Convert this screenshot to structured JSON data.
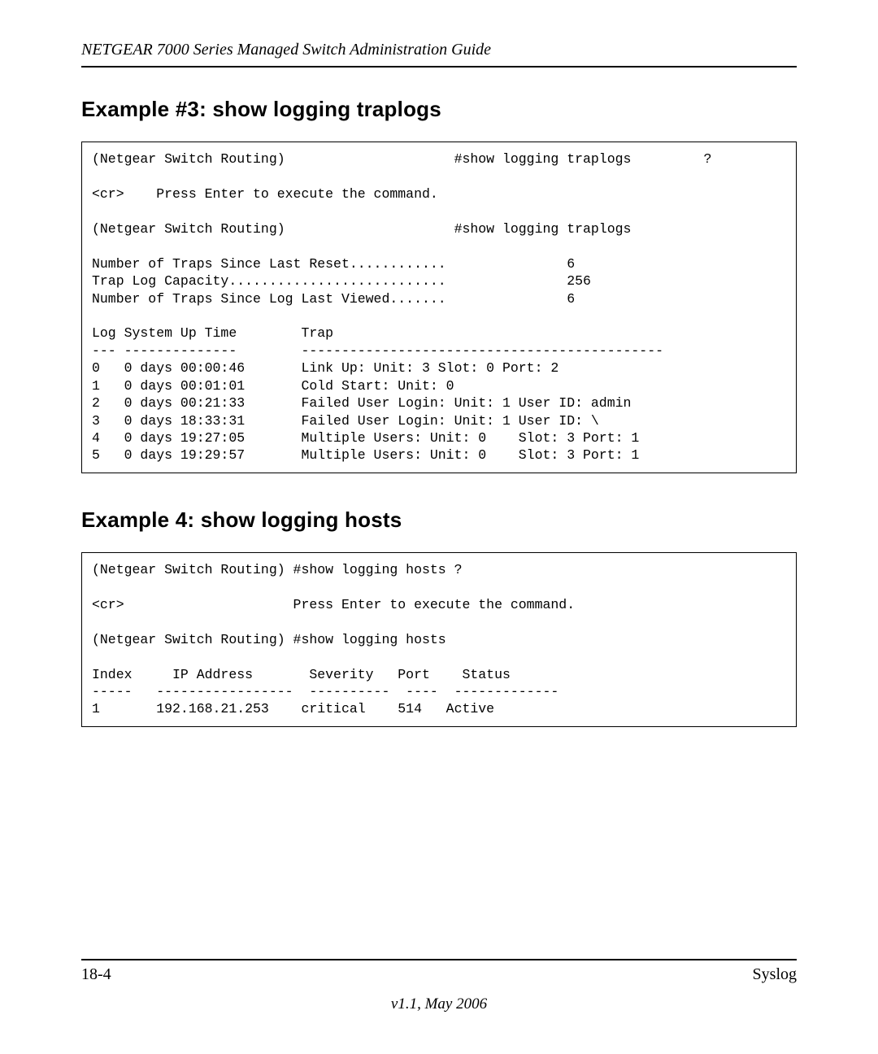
{
  "header": {
    "title": "NETGEAR 7000  Series Managed Switch Administration Guide"
  },
  "sections": {
    "example3": {
      "heading": "Example #3: show logging traplogs",
      "content": "(Netgear Switch Routing)                     #show logging traplogs         ?\n\n<cr>    Press Enter to execute the command.\n\n(Netgear Switch Routing)                     #show logging traplogs\n\nNumber of Traps Since Last Reset............               6\nTrap Log Capacity...........................               256\nNumber of Traps Since Log Last Viewed.......               6\n\nLog System Up Time        Trap\n--- --------------        ---------------------------------------------\n0   0 days 00:00:46       Link Up: Unit: 3 Slot: 0 Port: 2\n1   0 days 00:01:01       Cold Start: Unit: 0\n2   0 days 00:21:33       Failed User Login: Unit: 1 User ID: admin\n3   0 days 18:33:31       Failed User Login: Unit: 1 User ID: \\\n4   0 days 19:27:05       Multiple Users: Unit: 0    Slot: 3 Port: 1\n5   0 days 19:29:57       Multiple Users: Unit: 0    Slot: 3 Port: 1"
    },
    "example4": {
      "heading": "Example 4: show logging hosts",
      "content": "(Netgear Switch Routing) #show logging hosts ?\n\n<cr>                     Press Enter to execute the command.\n\n(Netgear Switch Routing) #show logging hosts\n\nIndex     IP Address       Severity   Port    Status\n-----   -----------------  ----------  ----  -------------\n1       192.168.21.253    critical    514   Active"
    }
  },
  "footer": {
    "page": "18-4",
    "chapter": "Syslog",
    "version": "v1.1, May 2006"
  }
}
